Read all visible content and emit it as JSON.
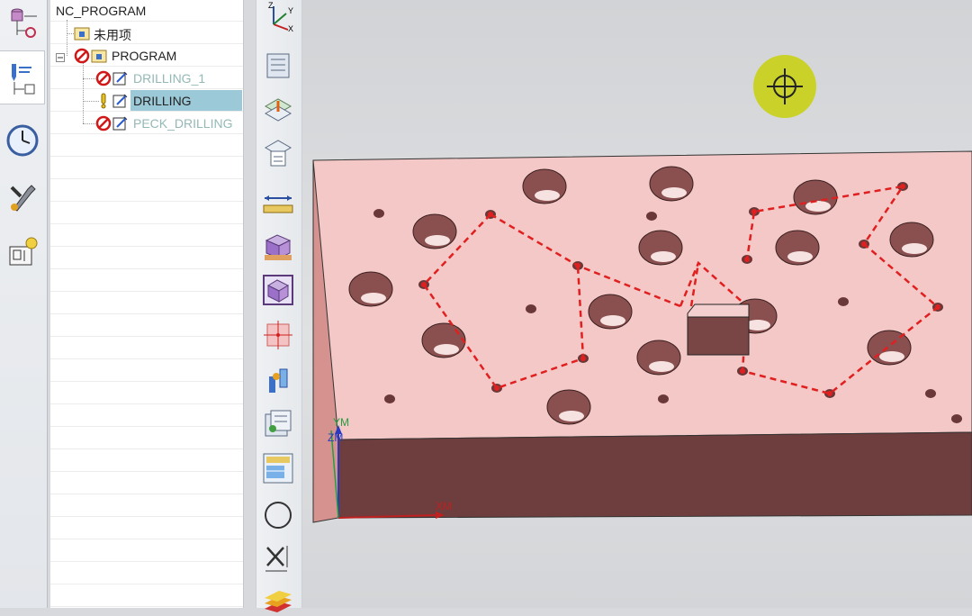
{
  "navigator": {
    "root": "NC_PROGRAM",
    "unused": "未用项",
    "program": "PROGRAM",
    "ops": [
      {
        "label": "DRILLING_1",
        "state": "gray",
        "icon": "no-entry-icon"
      },
      {
        "label": "DRILLING",
        "state": "selected",
        "icon": "exclamation-icon"
      },
      {
        "label": "PECK_DRILLING",
        "state": "gray",
        "icon": "no-entry-icon"
      }
    ]
  },
  "resource_bar": [
    "part-navigator-icon",
    "operation-navigator-icon",
    "history-clock-icon",
    "tool-wrench-icon",
    "machine-tool-icon"
  ],
  "toolbar": [
    "wcs-orient-icon",
    "program-order-view-icon",
    "machine-tool-view-icon",
    "geometry-view-icon",
    "measure-icon",
    "blank-icon",
    "box-icon",
    "point-icon",
    "tool-icon",
    "table-icon",
    "sheet-icon",
    "circle-icon",
    "dimension-icon",
    "layers-icon"
  ],
  "viewport": {
    "axes": {
      "x": "XM",
      "y": "YM",
      "z": "ZM"
    },
    "colors": {
      "top": "#f4c8c6",
      "front": "#6e3d3d",
      "side": "#d6928f",
      "toolpath": "#e02020",
      "cursor": "#c9d116"
    }
  }
}
